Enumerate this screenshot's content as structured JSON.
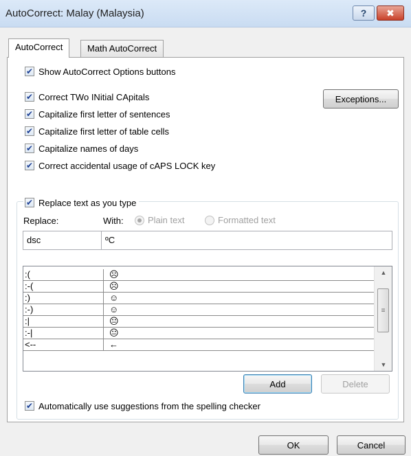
{
  "window": {
    "title": "AutoCorrect: Malay (Malaysia)",
    "help_glyph": "?",
    "close_glyph": "✖"
  },
  "tabs": [
    {
      "label": "AutoCorrect",
      "active": true
    },
    {
      "label": "Math AutoCorrect",
      "active": false
    }
  ],
  "options": {
    "show_buttons": "Show AutoCorrect Options buttons",
    "two_initials": "Correct TWo INitial CApitals",
    "first_letter_sentences": "Capitalize first letter of sentences",
    "first_letter_cells": "Capitalize first letter of table cells",
    "names_of_days": "Capitalize names of days",
    "caps_lock": "Correct accidental usage of cAPS LOCK key",
    "exceptions_button": "Exceptions..."
  },
  "replace": {
    "group_label": "Replace text as you type",
    "replace_label": "Replace:",
    "with_label": "With:",
    "plain_text": "Plain text",
    "formatted_text": "Formatted text",
    "replace_value": "dsc",
    "with_value": "ºC"
  },
  "entries": [
    {
      "from": ":(",
      "to": "☹"
    },
    {
      "from": ":-(",
      "to": "☹"
    },
    {
      "from": ":)",
      "to": "☺"
    },
    {
      "from": ":-)",
      "to": "☺"
    },
    {
      "from": ":|",
      "to": "😐"
    },
    {
      "from": ":-|",
      "to": "😐"
    },
    {
      "from": "<--",
      "to": "←"
    }
  ],
  "scroll": {
    "up": "▲",
    "down": "▼",
    "grip": "≡"
  },
  "buttons": {
    "add": "Add",
    "delete": "Delete",
    "ok": "OK",
    "cancel": "Cancel"
  },
  "spelling_suggestions": "Automatically use suggestions from the spelling checker"
}
